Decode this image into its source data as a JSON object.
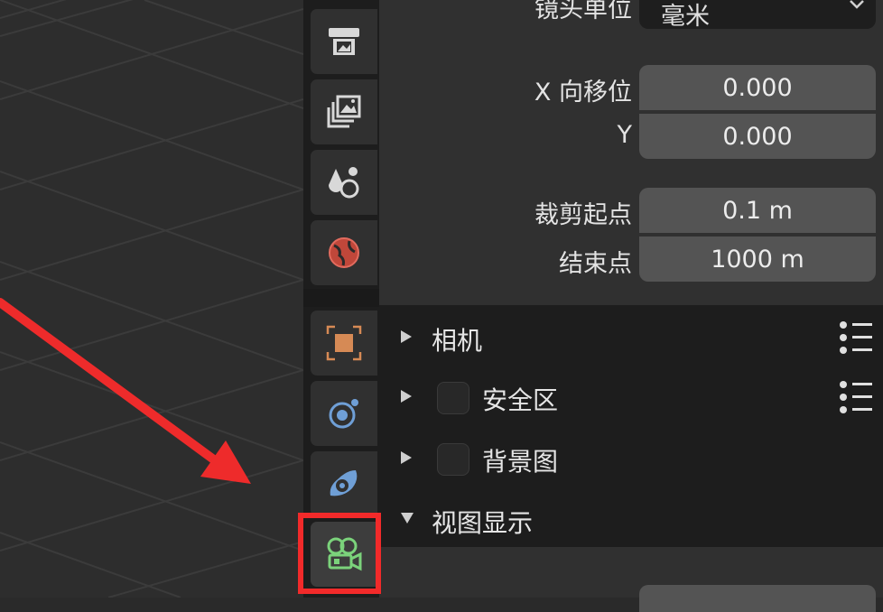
{
  "camera": {
    "lens_unit_label": "镜头单位",
    "lens_unit_value": "毫米",
    "shift_x_label": "X 向移位",
    "shift_x_value": "0.000",
    "shift_y_label": "Y",
    "shift_y_value": "0.000",
    "clip_start_label": "裁剪起点",
    "clip_start_value": "0.1 m",
    "clip_end_label": "结束点",
    "clip_end_value": "1000 m"
  },
  "sections": [
    {
      "label": "相机",
      "expanded": false,
      "has_checkbox": false,
      "has_menu": true
    },
    {
      "label": "安全区",
      "expanded": false,
      "has_checkbox": true,
      "has_menu": true
    },
    {
      "label": "背景图",
      "expanded": false,
      "has_checkbox": true,
      "has_menu": false
    },
    {
      "label": "视图显示",
      "expanded": true,
      "has_checkbox": false,
      "has_menu": false
    }
  ],
  "tabs": [
    "output-icon",
    "view-layer-icon",
    "scene-icon",
    "world-icon",
    "object-icon",
    "physics-icon",
    "constraints-icon",
    "camera-data-icon"
  ],
  "colors": {
    "highlight": "#f22a2a",
    "arrow": "#ee2b2b",
    "active_tab_icon": "#7bd27b",
    "object_orange": "#d68a55",
    "blue_icon": "#6f9fd6"
  }
}
